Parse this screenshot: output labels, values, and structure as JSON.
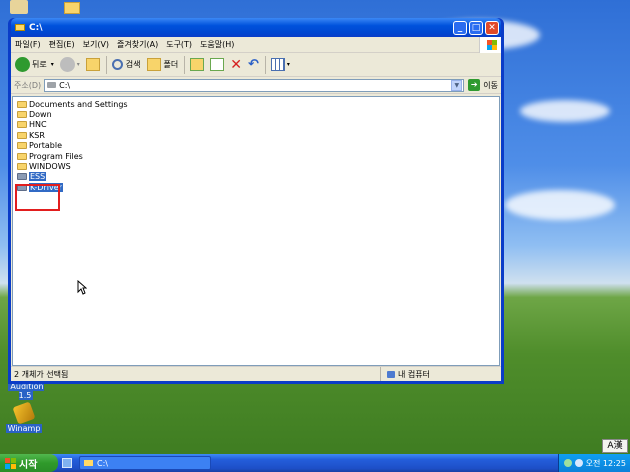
{
  "window": {
    "title": "C:\\",
    "menu": [
      "파일(F)",
      "편집(E)",
      "보기(V)",
      "즐겨찾기(A)",
      "도구(T)",
      "도움말(H)"
    ],
    "toolbar": {
      "back": "뒤로",
      "search": "검색",
      "folders": "폴더"
    },
    "address": {
      "label": "주소(D)",
      "value": "C:\\",
      "go": "이동"
    },
    "files": [
      {
        "name": "Documents and Settings",
        "selected": false
      },
      {
        "name": "Down",
        "selected": false
      },
      {
        "name": "HNC",
        "selected": false
      },
      {
        "name": "KSR",
        "selected": false
      },
      {
        "name": "Portable",
        "selected": false
      },
      {
        "name": "Program Files",
        "selected": false
      },
      {
        "name": "WINDOWS",
        "selected": false
      },
      {
        "name": "ESS",
        "selected": true
      },
      {
        "name": "K-Driver",
        "selected": true
      }
    ],
    "status": {
      "left": "2 개체가 선택됨",
      "right": "내 컴퓨터"
    }
  },
  "desktop": {
    "icons": [
      {
        "label": "Audition 1.5"
      },
      {
        "label": "Winamp"
      }
    ]
  },
  "taskbar": {
    "start": "시작",
    "task": "C:\\",
    "clock": "오전 12:25",
    "ime": "A漢"
  },
  "colors": {
    "selection": "#316ac5",
    "highlight_box": "#e21e1e",
    "titlebar": "#0052dc"
  }
}
